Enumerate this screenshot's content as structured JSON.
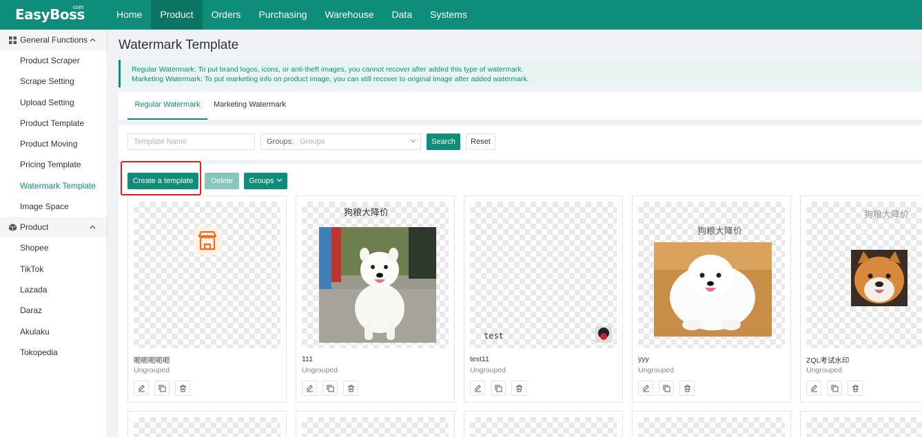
{
  "app": {
    "logo": "EasyBoss",
    "logo_suffix": "com"
  },
  "nav": [
    "Home",
    "Product",
    "Orders",
    "Purchasing",
    "Warehouse",
    "Data",
    "Systems"
  ],
  "nav_active": "Product",
  "sidebar": {
    "groups": [
      {
        "label": "General Functions",
        "icon": "grid-icon",
        "expanded": true,
        "items": [
          "Product Scraper",
          "Scrape Setting",
          "Upload Setting",
          "Product Template",
          "Product Moving",
          "Pricing Template",
          "Watermark Template",
          "Image Space"
        ]
      },
      {
        "label": "Product",
        "icon": "cube-icon",
        "expanded": true,
        "items": [
          "Shopee",
          "TikTok",
          "Lazada",
          "Daraz",
          "Akulaku",
          "Tokopedia"
        ]
      }
    ],
    "active_item": "Watermark Template"
  },
  "page": {
    "title": "Watermark Template",
    "notice_1": "Regular Watermark: To put brand logos, icons, or anti-theft images, you cannot recover after added this type of watermark.",
    "notice_2": "Marketing Watermark: To put marketing info on product image, you can still recover to original image after added watermark."
  },
  "tabs": {
    "regular": "Regular Watermark",
    "marketing": "Marketing Watermark",
    "active": "Regular Watermark"
  },
  "filters": {
    "template_name_placeholder": "Template Name",
    "groups_label": "Groups:",
    "groups_placeholder": "Groups",
    "search": "Search",
    "reset": "Reset"
  },
  "actions": {
    "create": "Create a template",
    "delete": "Delete",
    "groups": "Groups"
  },
  "cards": [
    {
      "name": "呃呃呃呃呃",
      "group": "Ungrouped",
      "watermark_text": ""
    },
    {
      "name": "111",
      "group": "Ungrouped",
      "watermark_text": "狗粮大降价"
    },
    {
      "name": "test11",
      "group": "Ungrouped",
      "watermark_text": "test"
    },
    {
      "name": "yyy",
      "group": "Ungrouped",
      "watermark_text": "狗粮大降价"
    },
    {
      "name": "ZQL考试水印",
      "group": "Ungrouped",
      "watermark_text": "狗粮大降价"
    }
  ],
  "colors": {
    "primary": "#0e8e7a",
    "highlight": "#e02020",
    "notice_bg": "#e8f4f1"
  }
}
